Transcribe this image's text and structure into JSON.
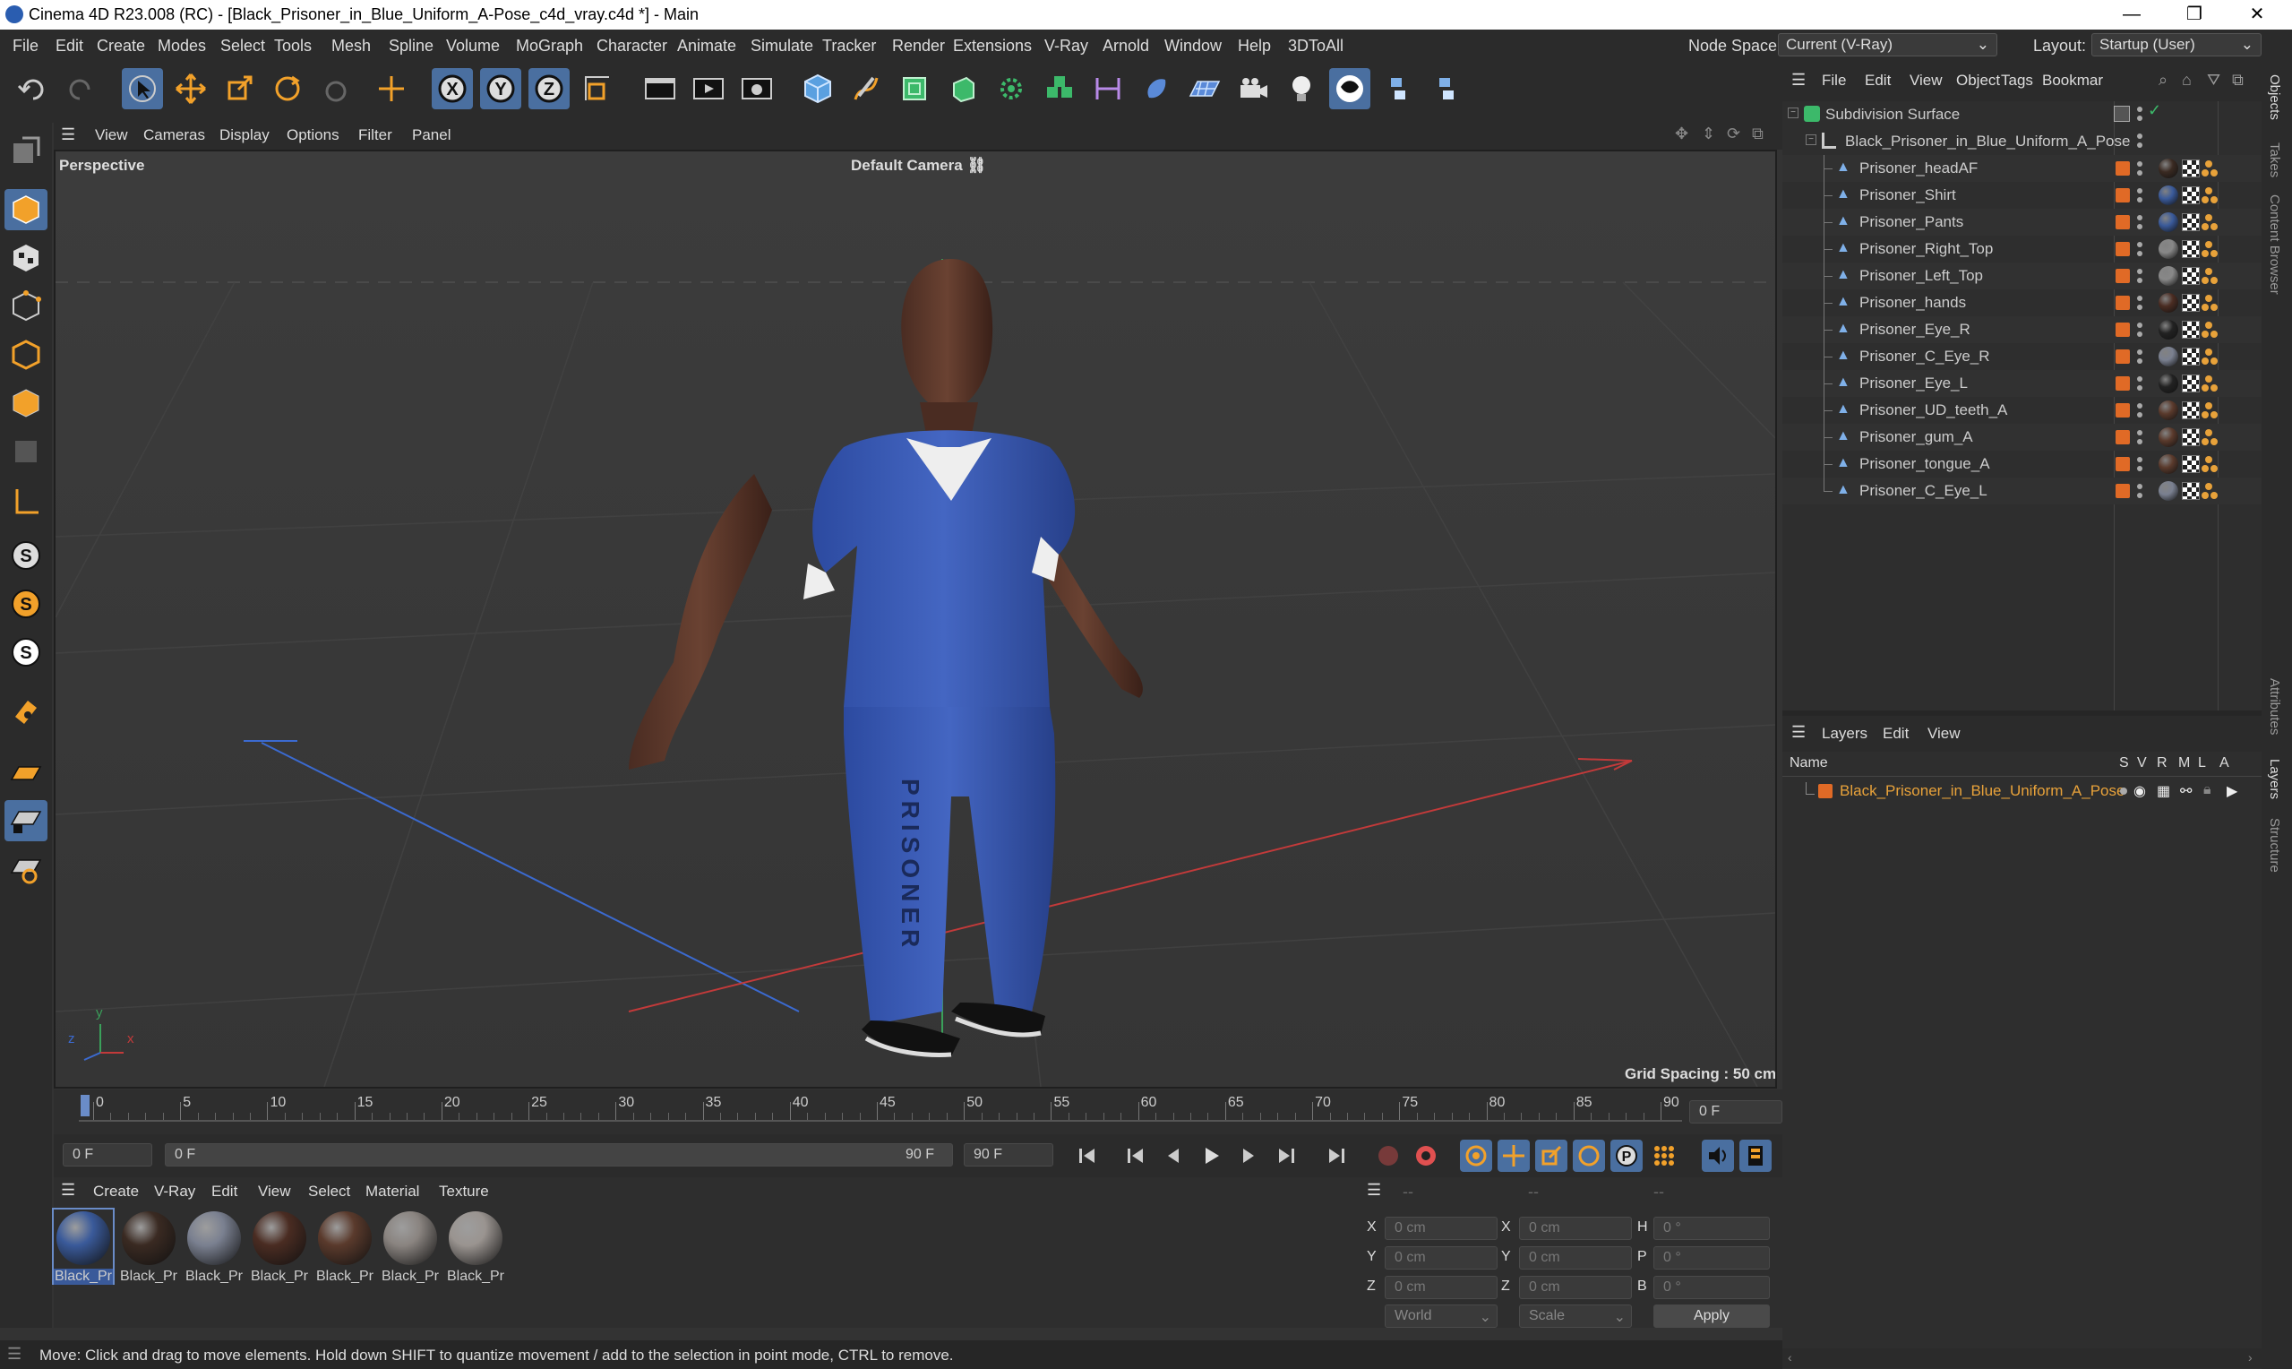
{
  "window": {
    "title": "Cinema 4D R23.008 (RC) - [Black_Prisoner_in_Blue_Uniform_A-Pose_c4d_vray.c4d *] - Main"
  },
  "menu": {
    "items": [
      "File",
      "Edit",
      "Create",
      "Modes",
      "Select",
      "Tools",
      "Mesh",
      "Spline",
      "Volume",
      "MoGraph",
      "Character",
      "Animate",
      "Simulate",
      "Tracker",
      "Render",
      "Extensions",
      "V-Ray",
      "Arnold",
      "Window",
      "Help",
      "3DToAll"
    ],
    "node_space_label": "Node Space:",
    "node_space_value": "Current (V-Ray)",
    "layout_label": "Layout:",
    "layout_value": "Startup (User)"
  },
  "viewport": {
    "menu": [
      "View",
      "Cameras",
      "Display",
      "Options",
      "Filter",
      "Panel"
    ],
    "label": "Perspective",
    "camera": "Default Camera",
    "grid_spacing": "Grid Spacing : 50 cm",
    "axis_x": "x",
    "axis_y": "y",
    "axis_z": "z"
  },
  "timeline": {
    "ticks": [
      "0",
      "5",
      "10",
      "15",
      "20",
      "25",
      "30",
      "35",
      "40",
      "45",
      "50",
      "55",
      "60",
      "65",
      "70",
      "75",
      "80",
      "85",
      "90"
    ],
    "current_frame": "0 F"
  },
  "transport": {
    "start_field": "0 F",
    "range_start": "0 F",
    "range_end": "90 F",
    "end_field": "90 F"
  },
  "materials": {
    "menu": [
      "Create",
      "V-Ray",
      "Edit",
      "View",
      "Select",
      "Material",
      "Texture"
    ],
    "items": [
      {
        "label": "Black_Pr",
        "color": "#3a5a9a"
      },
      {
        "label": "Black_Pr",
        "color": "#3a2a22"
      },
      {
        "label": "Black_Pr",
        "color": "#7a8090"
      },
      {
        "label": "Black_Pr",
        "color": "#4a2c22"
      },
      {
        "label": "Black_Pr",
        "color": "#5a3a2c"
      },
      {
        "label": "Black_Pr",
        "color": "#8a8480"
      },
      {
        "label": "Black_Pr",
        "color": "#9a9490"
      }
    ]
  },
  "coords": {
    "header_left": "--",
    "header_mid": "--",
    "header_right": "--",
    "rows": [
      {
        "a": "X",
        "av": "0 cm",
        "b": "X",
        "bv": "0 cm",
        "c": "H",
        "cv": "0 °"
      },
      {
        "a": "Y",
        "av": "0 cm",
        "b": "Y",
        "bv": "0 cm",
        "c": "P",
        "cv": "0 °"
      },
      {
        "a": "Z",
        "av": "0 cm",
        "b": "Z",
        "bv": "0 cm",
        "c": "B",
        "cv": "0 °"
      }
    ],
    "space": "World",
    "mode": "Scale",
    "apply": "Apply"
  },
  "objects": {
    "menu": [
      "File",
      "Edit",
      "View",
      "Object",
      "Tags",
      "Bookmar"
    ],
    "root": "Subdivision Surface",
    "group": "Black_Prisoner_in_Blue_Uniform_A_Pose",
    "children": [
      {
        "name": "Prisoner_headAF",
        "tag": "#3a2a22"
      },
      {
        "name": "Prisoner_Shirt",
        "tag": "#3a5a9a"
      },
      {
        "name": "Prisoner_Pants",
        "tag": "#3a5a9a"
      },
      {
        "name": "Prisoner_Right_Top",
        "tag": "#888"
      },
      {
        "name": "Prisoner_Left_Top",
        "tag": "#888"
      },
      {
        "name": "Prisoner_hands",
        "tag": "#4a2c22"
      },
      {
        "name": "Prisoner_Eye_R",
        "tag": "#222"
      },
      {
        "name": "Prisoner_C_Eye_R",
        "tag": "#7a8090"
      },
      {
        "name": "Prisoner_Eye_L",
        "tag": "#222"
      },
      {
        "name": "Prisoner_UD_teeth_A",
        "tag": "#5a3a2c"
      },
      {
        "name": "Prisoner_gum_A",
        "tag": "#5a3a2c"
      },
      {
        "name": "Prisoner_tongue_A",
        "tag": "#5a3a2c"
      },
      {
        "name": "Prisoner_C_Eye_L",
        "tag": "#7a8090"
      }
    ]
  },
  "layers": {
    "menu": [
      "Layers",
      "Edit",
      "View"
    ],
    "col_name": "Name",
    "cols": [
      "S",
      "V",
      "R",
      "M",
      "L",
      "A"
    ],
    "item": "Black_Prisoner_in_Blue_Uniform_A_Pose"
  },
  "side_tabs": [
    "Objects",
    "Takes",
    "Content Browser",
    "Attributes",
    "Layers",
    "Structure"
  ],
  "status": "Move: Click and drag to move elements. Hold down SHIFT to quantize movement / add to the selection in point mode, CTRL to remove.",
  "colors": {
    "accent": "#4a6fa0",
    "orange": "#e06a26",
    "layer_text": "#e8a23a"
  }
}
